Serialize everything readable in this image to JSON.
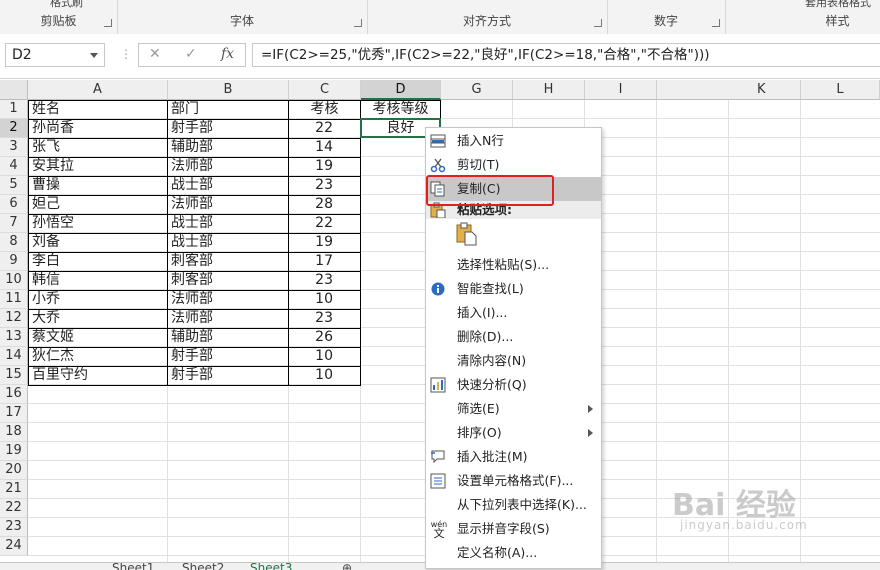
{
  "ribbon": {
    "groups": [
      "剪贴板",
      "字体",
      "对齐方式",
      "数字",
      "样式"
    ],
    "format_painter": "格式刷",
    "table_format": "套用表格格式"
  },
  "formula_bar": {
    "name_box": "D2",
    "cancel_icon": "✕",
    "enter_icon": "✓",
    "fx": "fx",
    "formula": "=IF(C2>=25,\"优秀\",IF(C2>=22,\"良好\",IF(C2>=18,\"合格\",\"不合格\")))"
  },
  "columns": [
    "A",
    "B",
    "C",
    "D",
    "G",
    "H",
    "I",
    "K",
    "L"
  ],
  "rows": [
    "1",
    "2",
    "3",
    "4",
    "5",
    "6",
    "7",
    "8",
    "9",
    "10",
    "11",
    "12",
    "13",
    "14",
    "15",
    "16",
    "17",
    "18",
    "19",
    "20",
    "21",
    "22",
    "23",
    "24"
  ],
  "table": {
    "header": [
      "姓名",
      "部门",
      "考核",
      "考核等级"
    ],
    "records": [
      {
        "name": "孙尚香",
        "dept": "射手部",
        "score": "22",
        "grade": "良好"
      },
      {
        "name": "张飞",
        "dept": "辅助部",
        "score": "14"
      },
      {
        "name": "安其拉",
        "dept": "法师部",
        "score": "19"
      },
      {
        "name": "曹操",
        "dept": "战士部",
        "score": "23"
      },
      {
        "name": "妲己",
        "dept": "法师部",
        "score": "28"
      },
      {
        "name": "孙悟空",
        "dept": "战士部",
        "score": "22"
      },
      {
        "name": "刘备",
        "dept": "战士部",
        "score": "19"
      },
      {
        "name": "李白",
        "dept": "刺客部",
        "score": "17"
      },
      {
        "name": "韩信",
        "dept": "刺客部",
        "score": "23"
      },
      {
        "name": "小乔",
        "dept": "法师部",
        "score": "10"
      },
      {
        "name": "大乔",
        "dept": "法师部",
        "score": "23"
      },
      {
        "name": "蔡文姬",
        "dept": "辅助部",
        "score": "26"
      },
      {
        "name": "狄仁杰",
        "dept": "射手部",
        "score": "10"
      },
      {
        "name": "百里守约",
        "dept": "射手部",
        "score": "10"
      }
    ]
  },
  "context_menu": {
    "items": [
      {
        "label": "插入N行",
        "icon": "insert-rows-icon"
      },
      {
        "label": "剪切(T)",
        "icon": "cut-icon"
      },
      {
        "label": "复制(C)",
        "icon": "copy-icon",
        "highlighted": true
      },
      {
        "label": "粘贴选项:",
        "icon": "paste-icon",
        "header": true
      },
      {
        "label": "",
        "icon": "paste-clipboard-icon"
      },
      {
        "label": "选择性粘贴(S)...",
        "icon": ""
      },
      {
        "label": "智能查找(L)",
        "icon": "smart-lookup-icon"
      },
      {
        "label": "插入(I)...",
        "icon": ""
      },
      {
        "label": "删除(D)...",
        "icon": ""
      },
      {
        "label": "清除内容(N)",
        "icon": ""
      },
      {
        "label": "快速分析(Q)",
        "icon": "quick-analysis-icon"
      },
      {
        "label": "筛选(E)",
        "icon": "",
        "submenu": true
      },
      {
        "label": "排序(O)",
        "icon": "",
        "submenu": true
      },
      {
        "label": "插入批注(M)",
        "icon": "insert-comment-icon"
      },
      {
        "label": "设置单元格格式(F)...",
        "icon": "format-cells-icon"
      },
      {
        "label": "从下拉列表中选择(K)...",
        "icon": ""
      },
      {
        "label": "显示拼音字段(S)",
        "icon": "phonetic-icon"
      },
      {
        "label": "定义名称(A)...",
        "icon": ""
      }
    ],
    "phonetic_glyph_top": "wén",
    "phonetic_glyph_bottom": "文"
  },
  "sheet_tabs": [
    "Sheet1",
    "Sheet2",
    "Sheet3"
  ],
  "active_sheet": "Sheet3",
  "watermark": {
    "logo": "Bai 经验",
    "url": "jingyan.baidu.com"
  },
  "colors": {
    "accent": "#217346",
    "highlight_box": "#e02020",
    "menu_highlight": "#c8c8c8"
  }
}
